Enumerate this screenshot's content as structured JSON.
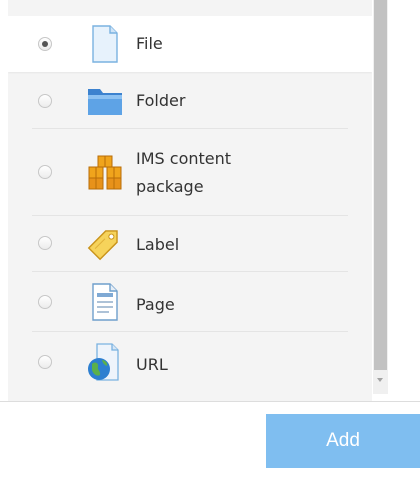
{
  "options": [
    {
      "label": "File",
      "icon": "file-icon",
      "selected": true
    },
    {
      "label": "Folder",
      "icon": "folder-icon",
      "selected": false
    },
    {
      "label": "IMS content",
      "label_line2": "package",
      "icon": "ims-package-icon",
      "selected": false
    },
    {
      "label": "Label",
      "icon": "label-tag-icon",
      "selected": false
    },
    {
      "label": "Page",
      "icon": "page-icon",
      "selected": false
    },
    {
      "label": "URL",
      "icon": "url-globe-icon",
      "selected": false
    }
  ],
  "footer": {
    "add_label": "Add"
  },
  "colors": {
    "add_button": "#7fbef0",
    "list_background": "#f4f4f4",
    "selected_row": "#ffffff"
  }
}
